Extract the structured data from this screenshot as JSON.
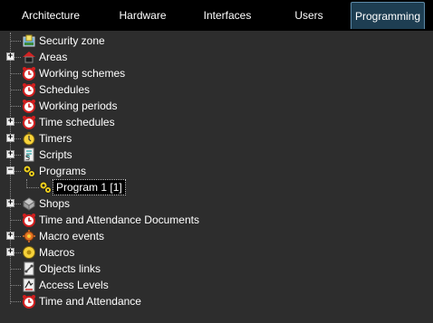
{
  "tabs": [
    {
      "label": "Architecture"
    },
    {
      "label": "Hardware"
    },
    {
      "label": "Interfaces"
    },
    {
      "label": "Users"
    },
    {
      "label": "Programming"
    }
  ],
  "active_tab": "Programming",
  "tree": {
    "items": [
      {
        "label": "Security zone",
        "icon": "security-zone-icon",
        "expandable": false
      },
      {
        "label": "Areas",
        "icon": "house-icon",
        "expandable": true,
        "expanded": false
      },
      {
        "label": "Working schemes",
        "icon": "alarm-clock-icon",
        "expandable": false
      },
      {
        "label": "Schedules",
        "icon": "alarm-clock-icon",
        "expandable": false
      },
      {
        "label": "Working periods",
        "icon": "alarm-clock-icon",
        "expandable": false
      },
      {
        "label": "Time schedules",
        "icon": "alarm-clock-icon",
        "expandable": true,
        "expanded": false
      },
      {
        "label": "Timers",
        "icon": "stopwatch-icon",
        "expandable": true,
        "expanded": false
      },
      {
        "label": "Scripts",
        "icon": "script-icon",
        "expandable": true,
        "expanded": false
      },
      {
        "label": "Programs",
        "icon": "gears-icon",
        "expandable": true,
        "expanded": true
      },
      {
        "label": "Program 1 [1]",
        "icon": "gears-icon",
        "expandable": false,
        "child": true,
        "selected": true
      },
      {
        "label": "Shops",
        "icon": "shop-icon",
        "expandable": true,
        "expanded": false
      },
      {
        "label": "Time and Attendance Documents",
        "icon": "alarm-clock-icon",
        "expandable": false
      },
      {
        "label": "Macro events",
        "icon": "macro-event-icon",
        "expandable": true,
        "expanded": false
      },
      {
        "label": "Macros",
        "icon": "macro-icon",
        "expandable": true,
        "expanded": false
      },
      {
        "label": "Objects links",
        "icon": "link-icon",
        "expandable": false
      },
      {
        "label": "Access Levels",
        "icon": "access-level-icon",
        "expandable": false
      },
      {
        "label": "Time and Attendance",
        "icon": "alarm-clock-icon",
        "expandable": false
      }
    ]
  }
}
